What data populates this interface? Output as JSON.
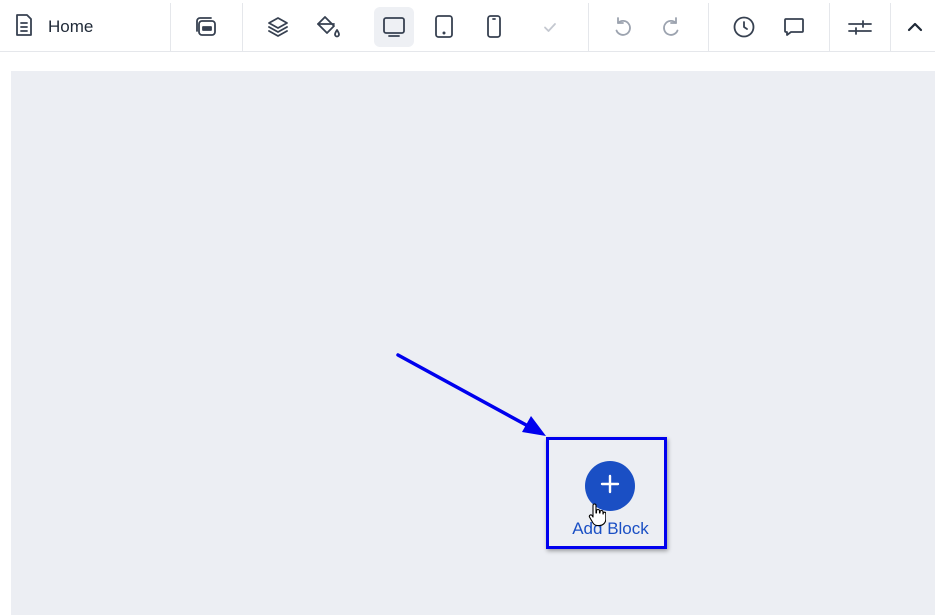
{
  "toolbar": {
    "page_name": "Home",
    "buttons": [
      {
        "name": "page-icon",
        "state": "normal"
      },
      {
        "name": "save-template-icon",
        "state": "normal"
      },
      {
        "name": "layers-icon",
        "state": "normal"
      },
      {
        "name": "paint-bucket-icon",
        "state": "normal"
      },
      {
        "name": "desktop-view-icon",
        "state": "active"
      },
      {
        "name": "tablet-view-icon",
        "state": "normal"
      },
      {
        "name": "mobile-view-icon",
        "state": "normal"
      },
      {
        "name": "checkmark-icon",
        "state": "disabled"
      },
      {
        "name": "undo-icon",
        "state": "disabled"
      },
      {
        "name": "redo-icon",
        "state": "disabled"
      },
      {
        "name": "history-clock-icon",
        "state": "normal"
      },
      {
        "name": "comment-icon",
        "state": "normal"
      },
      {
        "name": "settings-sliders-icon",
        "state": "normal"
      },
      {
        "name": "chevron-up-icon",
        "state": "normal"
      }
    ]
  },
  "canvas": {
    "add_block_label": "Add Block"
  },
  "colors": {
    "accent": "#1a4fc4",
    "annotation": "#0000ee",
    "canvas_bg": "#eceef3",
    "icon": "#374151",
    "icon_disabled": "#9ca3af"
  }
}
